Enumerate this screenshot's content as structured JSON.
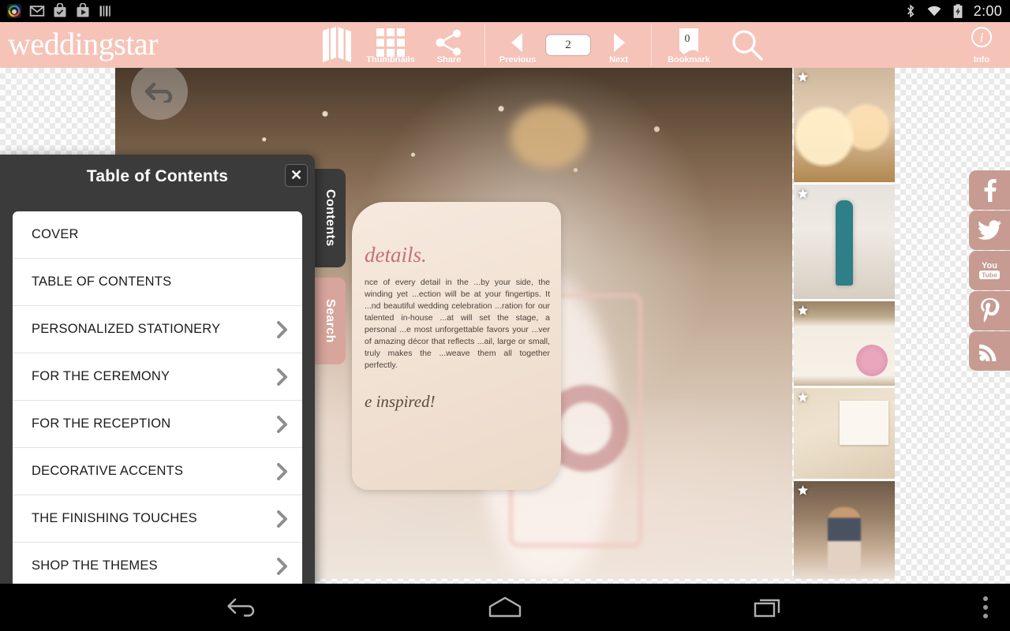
{
  "statusbar": {
    "time": "2:00",
    "left_icons": [
      "photos-icon",
      "gmail-icon",
      "tasks-icon",
      "play-store-icon",
      "barcode-icon"
    ],
    "right_icons": [
      "bluetooth-icon",
      "wifi-icon",
      "battery-charging-icon"
    ]
  },
  "toolbar": {
    "brand": "weddingstar",
    "thumbnails_label": "Thumbnails",
    "share_label": "Share",
    "previous_label": "Previous",
    "next_label": "Next",
    "bookmark_label": "Bookmark",
    "bookmark_count": "0",
    "page_number": "2",
    "info_label": "Info",
    "info_glyph": "i",
    "background_color": "#f6c3b8"
  },
  "side_tabs": {
    "contents": "Contents",
    "search": "Search"
  },
  "page": {
    "heading": "details.",
    "body": "nce of every detail in the ...by your side, the winding yet ...ection will be at your fingertips. It ...nd beautiful wedding celebration ...ration for our talented in-house ...at will set the stage, a personal ...e most unforgettable favors your ...ver of amazing décor that reflects ...ail, large or small, truly makes the ...weave them all together perfectly.",
    "signature": "e inspired!"
  },
  "toc": {
    "title": "Table of Contents",
    "close_label": "✕",
    "items": [
      {
        "label": "COVER",
        "has_chevron": false
      },
      {
        "label": "TABLE OF CONTENTS",
        "has_chevron": false
      },
      {
        "label": "PERSONALIZED STATIONERY",
        "has_chevron": true
      },
      {
        "label": "FOR THE CEREMONY",
        "has_chevron": true
      },
      {
        "label": "FOR THE RECEPTION",
        "has_chevron": true
      },
      {
        "label": "DECORATIVE ACCENTS",
        "has_chevron": true
      },
      {
        "label": "THE FINISHING TOUCHES",
        "has_chevron": true
      },
      {
        "label": "SHOP THE THEMES",
        "has_chevron": true
      }
    ],
    "panel_color": "#3b3b3b"
  },
  "social": {
    "accent_color": "#c79b92",
    "items": [
      {
        "name": "facebook-icon",
        "label": "Facebook"
      },
      {
        "name": "twitter-icon",
        "label": "Twitter"
      },
      {
        "name": "youtube-icon",
        "label": "YouTube"
      },
      {
        "name": "pinterest-icon",
        "label": "Pinterest"
      },
      {
        "name": "rss-icon",
        "label": "RSS"
      }
    ]
  },
  "thumbnail_rail": {
    "count": 5,
    "items": [
      {
        "name": "thumbnail-votive-candles",
        "bookmarked": true
      },
      {
        "name": "thumbnail-teal-key",
        "bookmarked": true
      },
      {
        "name": "thumbnail-invitation-suite",
        "bookmarked": true
      },
      {
        "name": "thumbnail-thank-you-tag",
        "bookmarked": true
      },
      {
        "name": "thumbnail-cake-topper",
        "bookmarked": true
      }
    ]
  },
  "navbar": {
    "back_label": "Back",
    "home_label": "Home",
    "recents_label": "Recent apps",
    "overflow_label": "More options"
  }
}
